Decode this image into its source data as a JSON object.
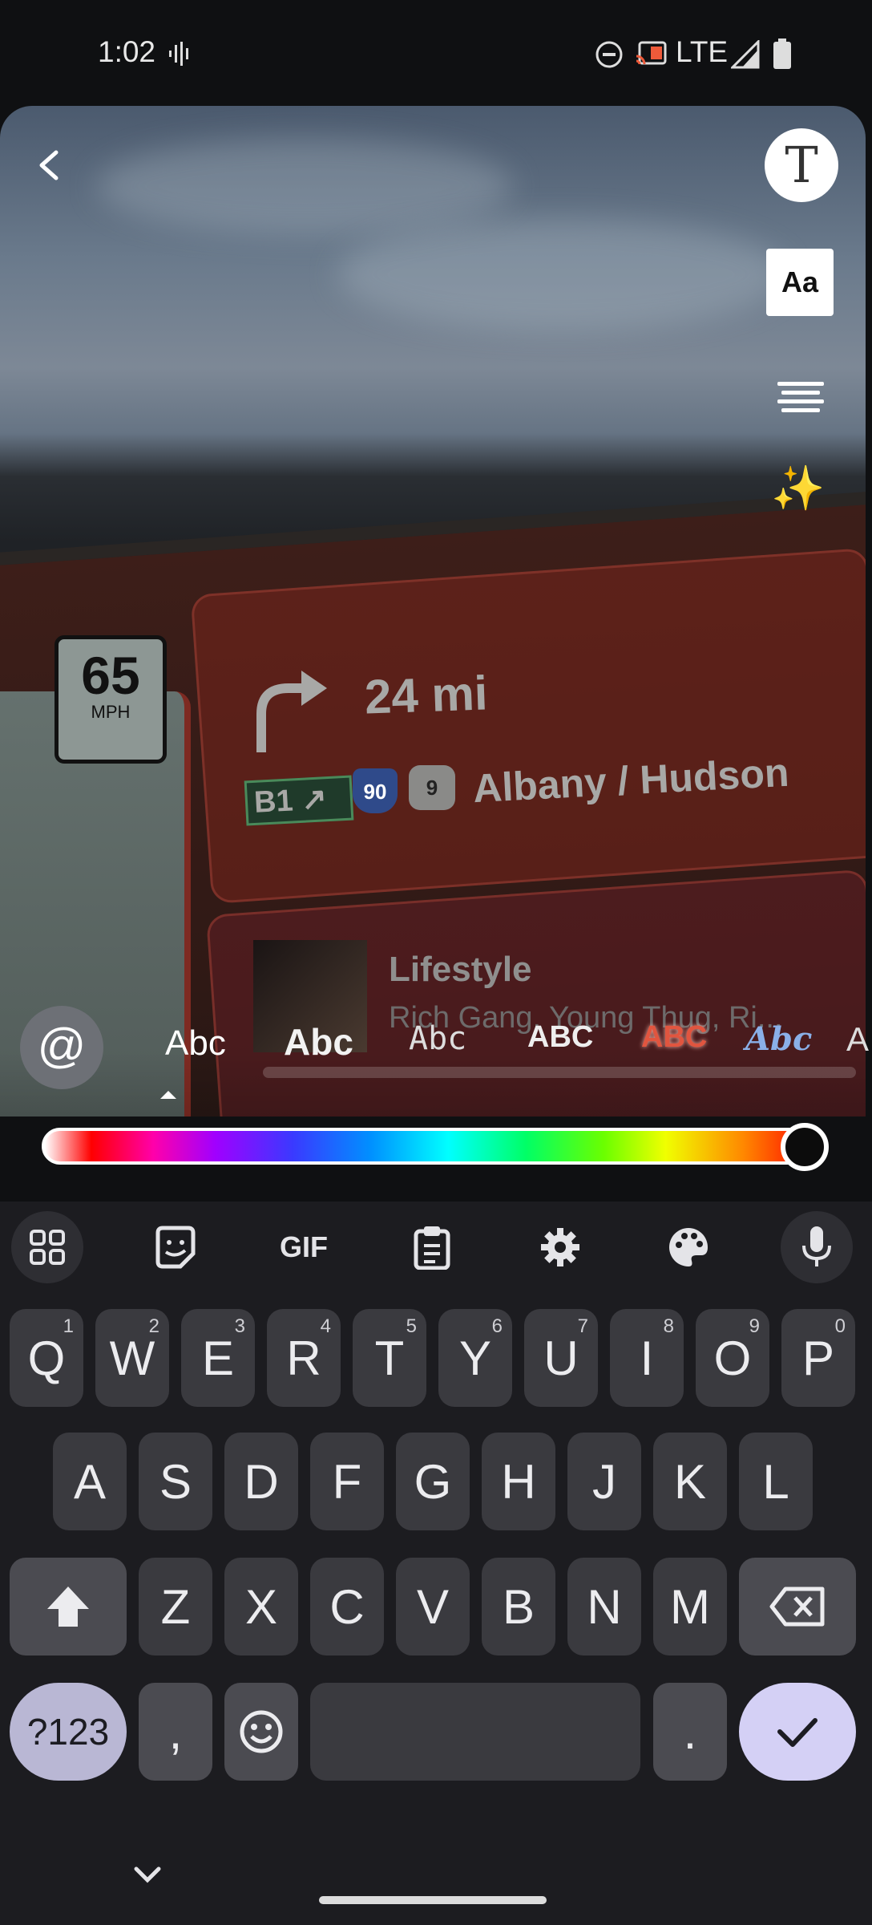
{
  "status_bar": {
    "time": "1:02",
    "network": "LTE"
  },
  "photo": {
    "speed_limit_number": "65",
    "speed_limit_unit": "MPH",
    "nav_distance": "24 mi",
    "nav_exit": "B1",
    "nav_route_1": "90",
    "nav_route_2": "9",
    "nav_destination": "Albany / Hudson",
    "media_title": "Lifestyle",
    "media_artist": "Rich Gang, Young Thug, Ri..."
  },
  "tools": {
    "text_icon": "T",
    "font_style_label": "Aa"
  },
  "font_strip": {
    "mention_label": "@",
    "options": [
      "Abc",
      "Abc",
      "Abc",
      "ABC",
      "ABC",
      "Abc",
      "A"
    ]
  },
  "color_slider": {
    "selected_color": "#000000",
    "position": 1.0
  },
  "keyboard": {
    "toolbar_gif": "GIF",
    "row1": [
      {
        "k": "Q",
        "n": "1"
      },
      {
        "k": "W",
        "n": "2"
      },
      {
        "k": "E",
        "n": "3"
      },
      {
        "k": "R",
        "n": "4"
      },
      {
        "k": "T",
        "n": "5"
      },
      {
        "k": "Y",
        "n": "6"
      },
      {
        "k": "U",
        "n": "7"
      },
      {
        "k": "I",
        "n": "8"
      },
      {
        "k": "O",
        "n": "9"
      },
      {
        "k": "P",
        "n": "0"
      }
    ],
    "row2": [
      "A",
      "S",
      "D",
      "F",
      "G",
      "H",
      "J",
      "K",
      "L"
    ],
    "row3": [
      "Z",
      "X",
      "C",
      "V",
      "B",
      "N",
      "M"
    ],
    "symbols_key": "?123",
    "comma_key": ",",
    "period_key": "."
  }
}
